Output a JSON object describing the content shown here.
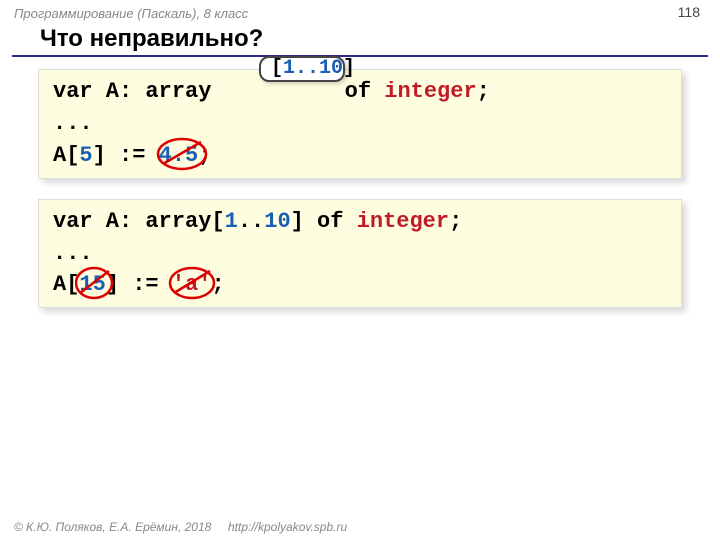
{
  "meta": {
    "course": "Программирование (Паскаль), 8 класс",
    "page_number": "118"
  },
  "title": "Что неправильно?",
  "callout": {
    "open": "[",
    "range": "1..10",
    "close": "]"
  },
  "block1": {
    "l1_a": "var A: array",
    "l1_b": " of ",
    "l1_type": "integer",
    "l1_c": ";",
    "l2": "...",
    "l3_a": "A[",
    "l3_idx": "5",
    "l3_b": "] := ",
    "l3_bad": "4.5",
    "l3_c": ";"
  },
  "block2": {
    "l1_a": "var A: array[",
    "l1_r1": "1",
    "l1_dots": "..",
    "l1_r2": "10",
    "l1_b": "] of ",
    "l1_type": "integer",
    "l1_c": ";",
    "l2": "...",
    "l3_a": "A[",
    "l3_bad1": "15",
    "l3_b": "] := ",
    "l3_bad2": "'a'",
    "l3_c": ";"
  },
  "footer": {
    "copyright": "© К.Ю. Поляков, Е.А. Ерёмин, 2018",
    "url": "http://kpolyakov.spb.ru"
  }
}
